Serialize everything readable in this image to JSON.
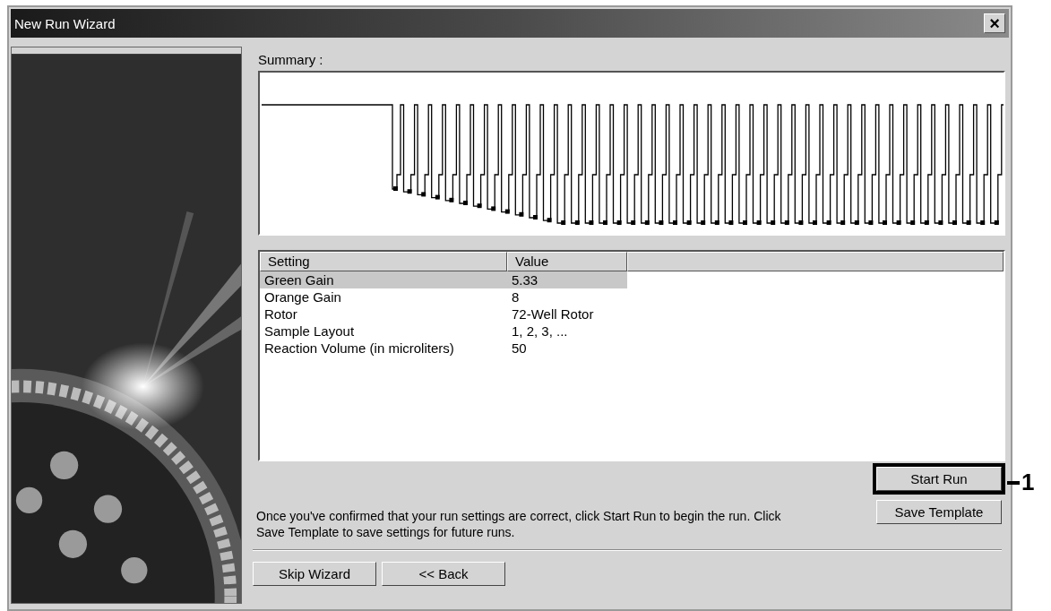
{
  "window": {
    "title": "New Run Wizard",
    "close": "×"
  },
  "summary": {
    "label": "Summary :"
  },
  "table": {
    "columns": [
      "Setting",
      "Value"
    ],
    "rows": [
      {
        "setting": "Green Gain",
        "value": "5.33",
        "selected": true
      },
      {
        "setting": "Orange Gain",
        "value": "8",
        "selected": false
      },
      {
        "setting": "Rotor",
        "value": "72-Well Rotor",
        "selected": false
      },
      {
        "setting": "Sample Layout",
        "value": "1, 2, 3, ...",
        "selected": false
      },
      {
        "setting": "Reaction Volume (in microliters)",
        "value": "50",
        "selected": false
      }
    ]
  },
  "instructions": "Once you've confirmed that your run settings are correct, click Start Run to begin the run. Click Save Template to save settings for future runs.",
  "side_buttons": [
    {
      "label": "Start Run",
      "highlighted": true
    },
    {
      "label": "Save Template",
      "highlighted": false
    }
  ],
  "callout": {
    "label": "1"
  },
  "footer_buttons": [
    "Skip Wizard",
    "<< Back"
  ]
}
